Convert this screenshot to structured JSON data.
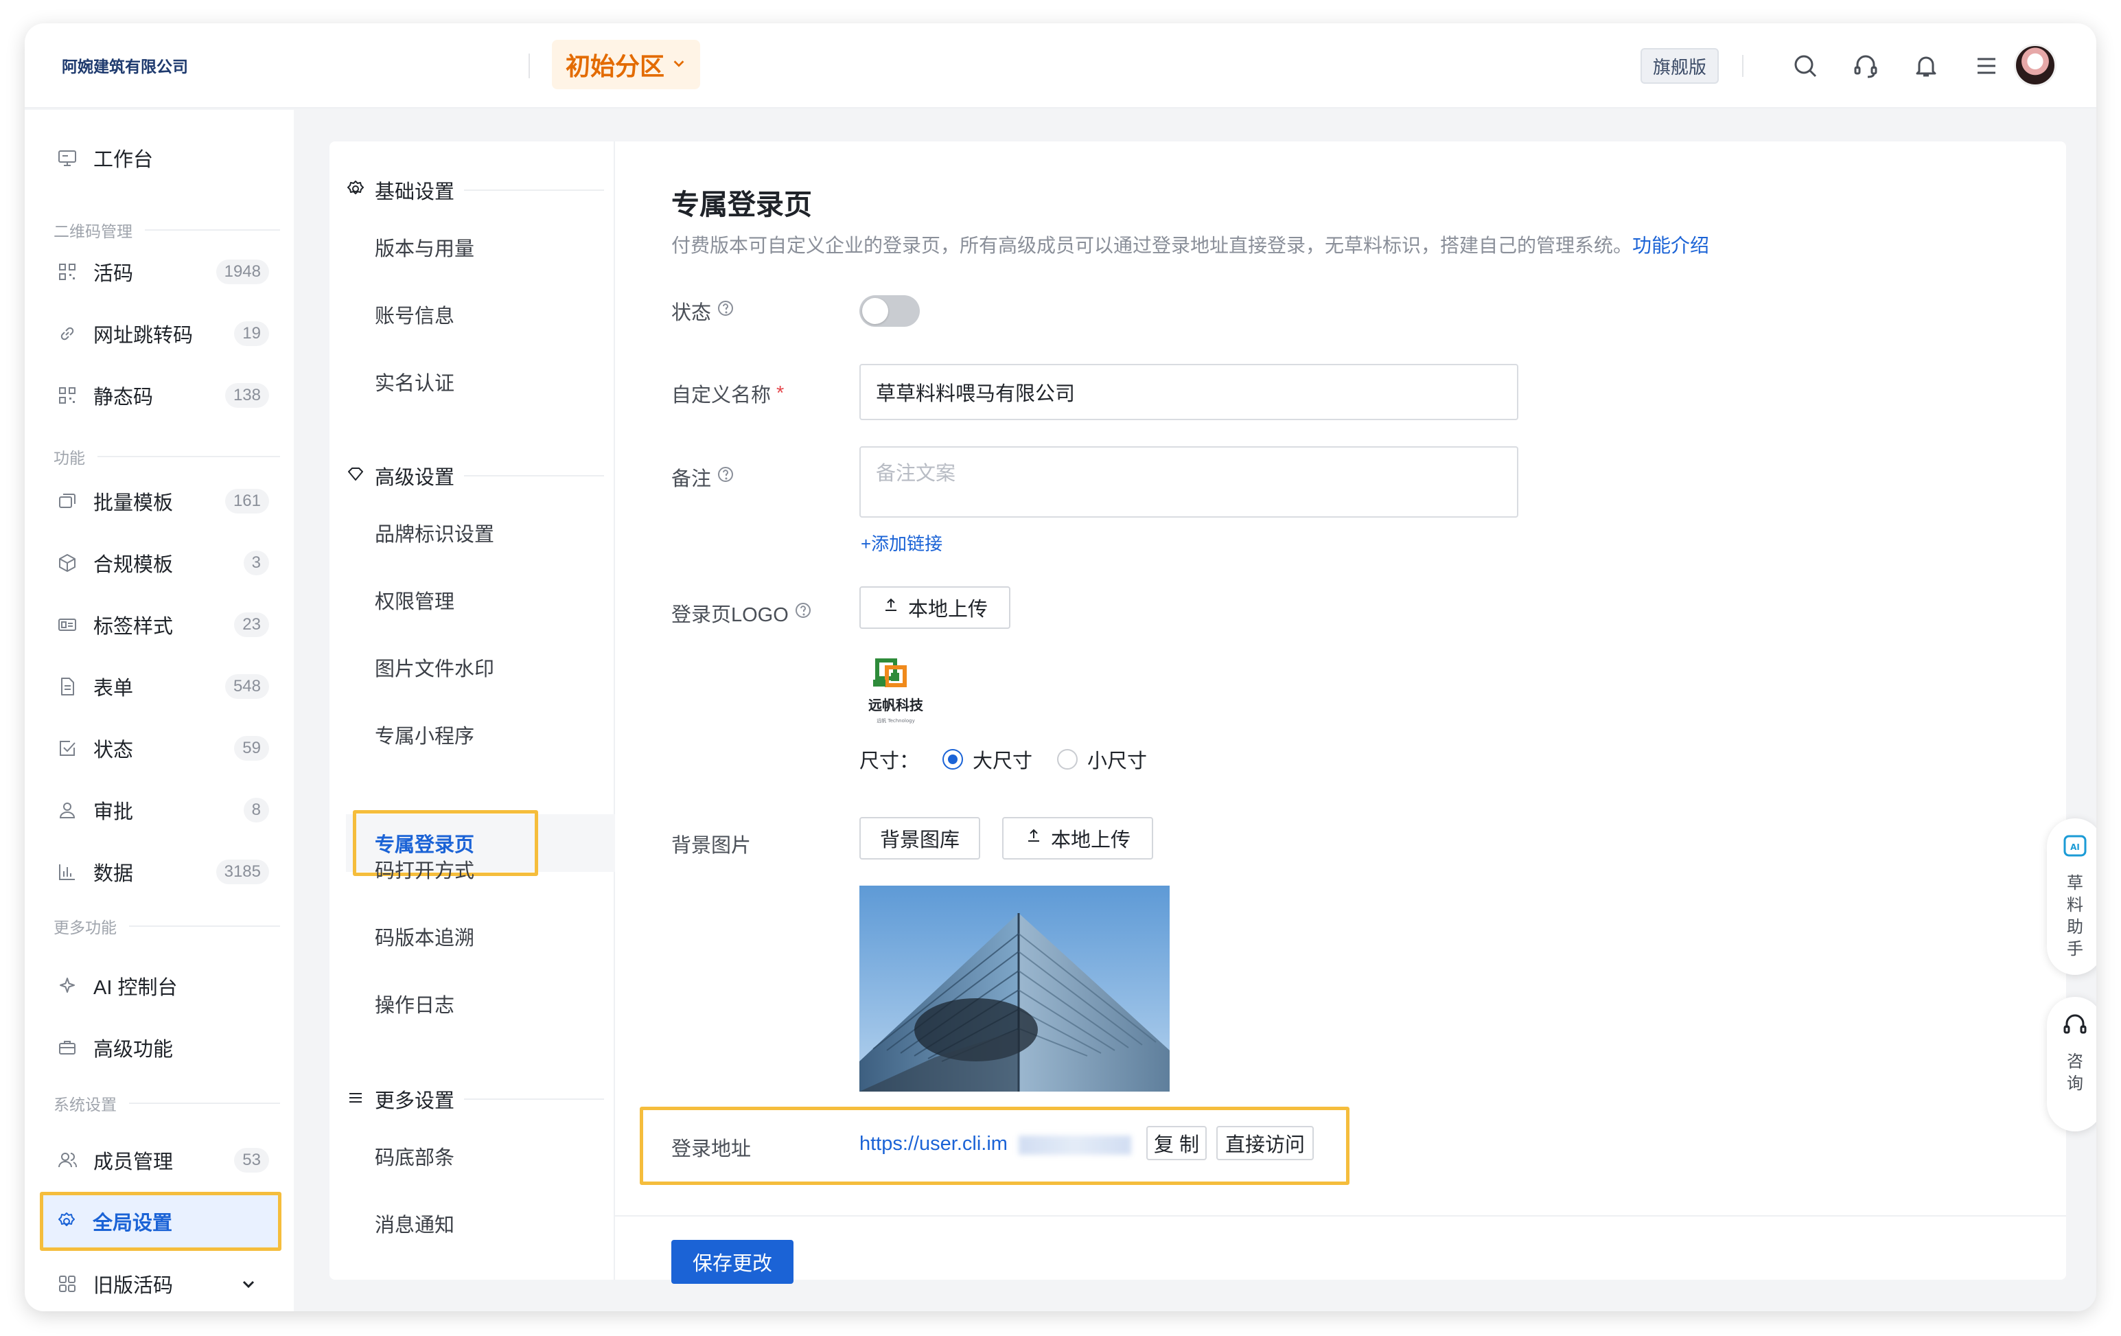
{
  "header": {
    "company": "阿婉建筑有限公司",
    "region": "初始分区",
    "version_badge": "旗舰版"
  },
  "sidebar": {
    "workspace": "工作台",
    "sections": {
      "qr": "二维码管理",
      "func": "功能",
      "more": "更多功能",
      "sys": "系统设置"
    },
    "items": [
      {
        "label": "活码",
        "count": "1948"
      },
      {
        "label": "网址跳转码",
        "count": "19"
      },
      {
        "label": "静态码",
        "count": "138"
      },
      {
        "label": "批量模板",
        "count": "161"
      },
      {
        "label": "合规模板",
        "count": "3"
      },
      {
        "label": "标签样式",
        "count": "23"
      },
      {
        "label": "表单",
        "count": "548"
      },
      {
        "label": "状态",
        "count": "59"
      },
      {
        "label": "审批",
        "count": "8"
      },
      {
        "label": "数据",
        "count": "3185"
      },
      {
        "label": "AI 控制台",
        "count": ""
      },
      {
        "label": "高级功能",
        "count": ""
      },
      {
        "label": "成员管理",
        "count": "53"
      },
      {
        "label": "全局设置",
        "count": ""
      },
      {
        "label": "旧版活码",
        "count": ""
      }
    ]
  },
  "subnav": {
    "groups": [
      "基础设置",
      "高级设置",
      "更多设置"
    ],
    "basic": [
      "版本与用量",
      "账号信息",
      "实名认证"
    ],
    "advanced": [
      "品牌标识设置",
      "权限管理",
      "图片文件水印",
      "专属小程序",
      "专属登录页",
      "码打开方式",
      "码版本追溯",
      "操作日志"
    ],
    "more": [
      "码底部条",
      "消息通知"
    ]
  },
  "main": {
    "title": "专属登录页",
    "desc": "付费版本可自定义企业的登录页，所有高级成员可以通过登录地址直接登录，无草料标识，搭建自己的管理系统。",
    "desc_link": "功能介绍",
    "status_label": "状态",
    "name_label": "自定义名称",
    "name_value": "草草料料喂马有限公司",
    "note_label": "备注",
    "note_placeholder": "备注文案",
    "add_link": "+添加链接",
    "logo_label": "登录页LOGO",
    "upload_local": "本地上传",
    "logo_text": "远帆科技",
    "logo_subtext": "远帆 Technology",
    "size_label": "尺寸：",
    "size_large": "大尺寸",
    "size_small": "小尺寸",
    "bg_label": "背景图片",
    "bg_gallery": "背景图库",
    "bg_upload": "本地上传",
    "url_label": "登录地址",
    "url_value": "https://user.cli.im",
    "copy": "复 制",
    "visit": "直接访问",
    "save": "保存更改"
  },
  "float": {
    "assistant": "草料助手",
    "consult": "咨询"
  },
  "colors": {
    "accent": "#1b63d6",
    "highlight": "#f5bd3c",
    "region": "#e36b00"
  }
}
